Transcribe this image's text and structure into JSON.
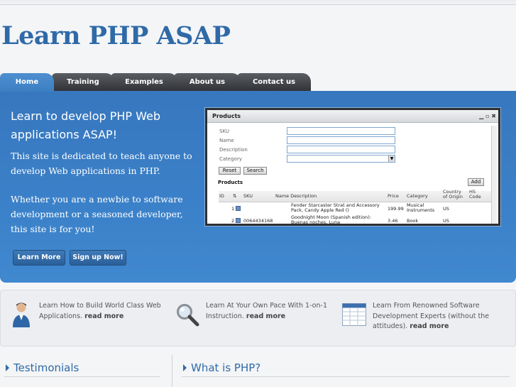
{
  "site": {
    "title": "Learn PHP ASAP"
  },
  "nav": {
    "tabs": [
      {
        "label": "Home",
        "active": true
      },
      {
        "label": "Training"
      },
      {
        "label": "Examples"
      },
      {
        "label": "About us"
      },
      {
        "label": "Contact us"
      }
    ]
  },
  "hero": {
    "heading": "Learn to develop PHP Web applications ASAP!",
    "paragraph1": "This site is dedicated to teach anyone to develop Web applications in PHP.",
    "paragraph2": "Whether you are a newbie to software development or a seasoned developer, this site is for you!",
    "learn_more_label": "Learn More",
    "signup_label": "Sign up Now!"
  },
  "products_window": {
    "title": "Products",
    "fields": {
      "sku": "SKU",
      "name": "Name",
      "description": "Description",
      "category": "Category"
    },
    "reset_label": "Reset",
    "search_label": "Search",
    "section_label": "Products",
    "add_label": "Add",
    "columns": {
      "id": "ID",
      "sku": "SKU",
      "name_description": "Name Description",
      "price": "Price",
      "category": "Category",
      "origin": "Country of Origin",
      "hs": "HS Code"
    },
    "rows": [
      {
        "id": "1",
        "sku": "",
        "name": "Fender Starcaster Strat and Accessory Pack, Candy Apple Red ()",
        "price": "199.99",
        "category": "Musical Instruments",
        "origin": "US"
      },
      {
        "id": "2",
        "sku": "0064434168",
        "name": "Goodnight Moon (Spanish edition): Buenas noches, Luna",
        "price": "3.46",
        "category": "Book",
        "origin": "US"
      }
    ]
  },
  "features": [
    {
      "text": "Learn How to Build World Class Web Applications.",
      "link": "read more",
      "icon": "user-icon"
    },
    {
      "text": "Learn At Your Own Pace With 1-on-1 Instruction.",
      "link": "read more",
      "icon": "magnifier-icon"
    },
    {
      "text": "Learn From Renowned Software Development Experts (without the attitudes).",
      "link": "read more",
      "icon": "table-icon"
    }
  ],
  "sections": {
    "testimonials": "Testimonials",
    "what_is_php": "What is PHP?"
  },
  "colors": {
    "brand_blue": "#2f6aa7",
    "hero_blue": "#3b81c9",
    "tab_dark": "#3a3c40"
  }
}
